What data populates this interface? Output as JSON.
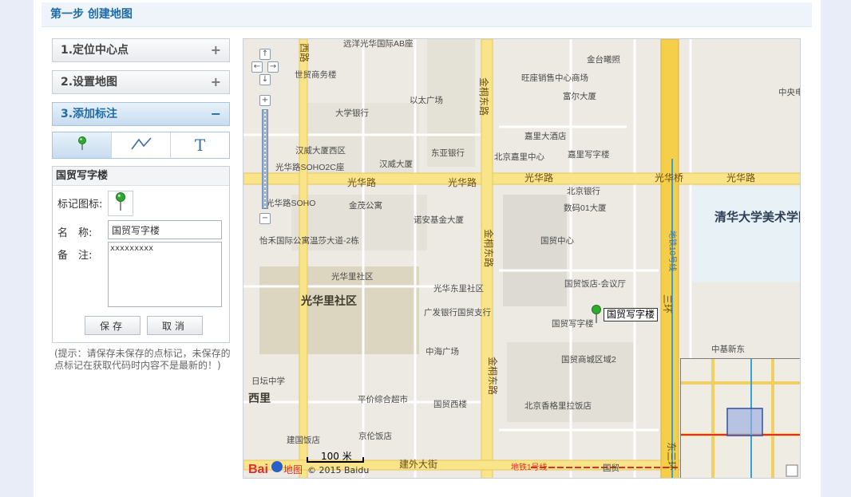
{
  "step": {
    "title": "第一步 创建地图"
  },
  "accordion": [
    {
      "label": "1.定位中心点",
      "sign": "+"
    },
    {
      "label": "2.设置地图",
      "sign": "+"
    },
    {
      "label": "3.添加标注",
      "sign": "−"
    }
  ],
  "tools": {
    "marker_icon": "marker-pin-icon",
    "line_icon": "polyline-icon",
    "text_label": "T"
  },
  "editor": {
    "title": "国贸写字楼",
    "icon_label": "标记图标:",
    "name_label": "名　称:",
    "name_value": "国贸写字楼",
    "note_label": "备　注:",
    "note_value": "xxxxxxxxx",
    "save_label": "保存",
    "cancel_label": "取消"
  },
  "tip": "(提示：请保存未保存的点标记，未保存的点标记在获取代码时内容不是最新的！)",
  "map": {
    "marker_label": "国贸写字楼",
    "scale": "100 米",
    "copyright": "© 2015 Baidu",
    "logo": "Bai地图",
    "road_labels": [
      "光华路",
      "光华路",
      "光华桥",
      "光华路",
      "光华路",
      "金桐东路",
      "金桐东路",
      "金桐东路",
      "建外大街",
      "地铁1号线",
      "地铁10号线",
      "西路",
      "三环",
      "东三环"
    ],
    "poi_labels": [
      "远洋光华国际AB座",
      "金台曦照",
      "世贸商务楼",
      "旺座销售中心商场",
      "富尔大厦",
      "中央电",
      "大学银行",
      "以太广场",
      "嘉里大酒店",
      "汉威大厦西区",
      "东亚银行",
      "北京嘉里中心",
      "嘉里写字楼",
      "光华路SOHO2C座",
      "汉威大厦",
      "北京银行",
      "光华路SOHO",
      "金茂公寓",
      "诺安基金大厦",
      "数码01大厦",
      "国贸中心",
      "怡禾国际公寓温莎大道-2栋",
      "光华里社区",
      "光华东里社区",
      "国贸饭店-会议厅",
      "广发银行国贸支行",
      "国贸写字楼",
      "中海广场",
      "国贸商城区域2",
      "中基新东",
      "日坛中学",
      "平价综合超市",
      "国贸西楼",
      "北京香格里拉饭店",
      "建国饭店",
      "京伦饭店",
      "朝外",
      "国贸"
    ],
    "area_labels": [
      "光华里社区",
      "清华大学美术学院",
      "西里"
    ]
  }
}
